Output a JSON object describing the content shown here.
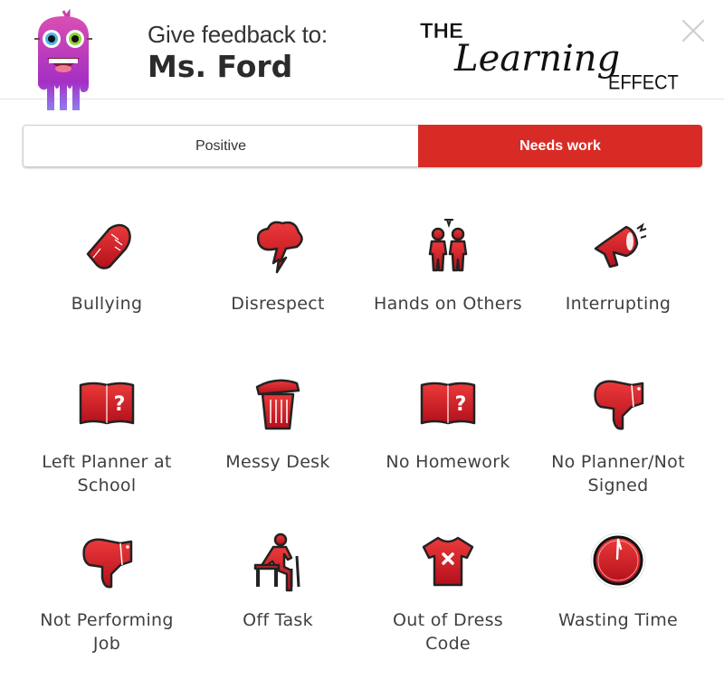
{
  "header": {
    "subtitle": "Give feedback to:",
    "recipient": "Ms. Ford",
    "logo": {
      "line1": "THE",
      "line2": "Learning",
      "line3": "EFFECT"
    },
    "close_icon": "close-icon"
  },
  "toggle": {
    "positive_label": "Positive",
    "needs_work_label": "Needs work",
    "selected": "Needs work",
    "active_color": "#d92b25"
  },
  "behaviors": [
    {
      "label": "Bullying",
      "icon": "fist-icon"
    },
    {
      "label": "Disrespect",
      "icon": "storm-cloud-icon"
    },
    {
      "label": "Hands on Others",
      "icon": "two-people-icon"
    },
    {
      "label": "Interrupting",
      "icon": "megaphone-icon"
    },
    {
      "label": "Left Planner at School",
      "icon": "book-question-icon"
    },
    {
      "label": "Messy Desk",
      "icon": "trash-can-icon"
    },
    {
      "label": "No Homework",
      "icon": "book-question-icon"
    },
    {
      "label": "No Planner/Not Signed",
      "icon": "thumbs-down-icon"
    },
    {
      "label": "Not Performing Job",
      "icon": "thumbs-down-icon"
    },
    {
      "label": "Off Task",
      "icon": "student-desk-icon"
    },
    {
      "label": "Out of Dress Code",
      "icon": "tshirt-x-icon"
    },
    {
      "label": "Wasting Time",
      "icon": "clock-icon"
    }
  ]
}
